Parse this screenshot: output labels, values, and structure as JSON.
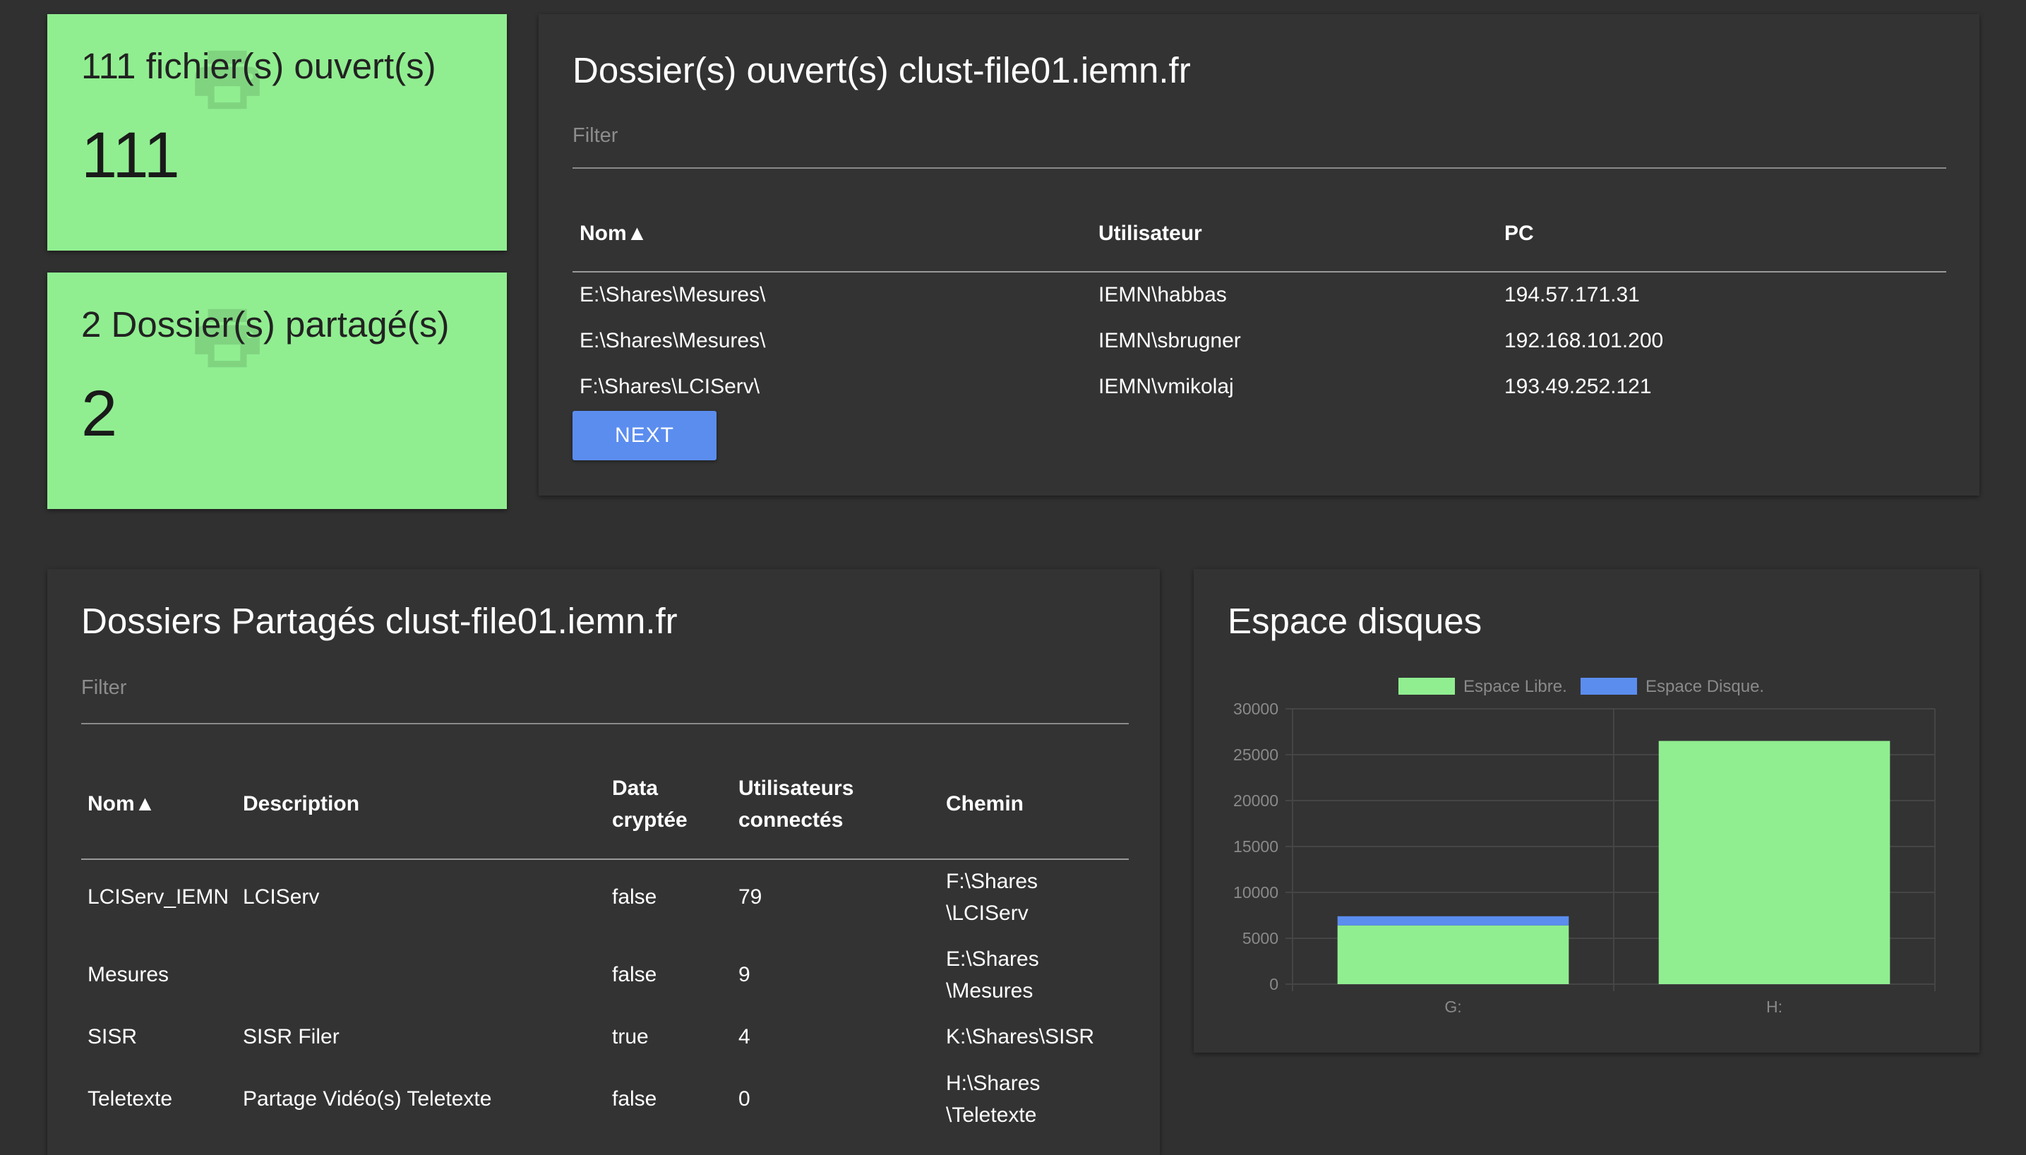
{
  "stats": [
    {
      "label": "111 fichier(s) ouvert(s)",
      "value": "111",
      "icon": "printer-icon"
    },
    {
      "label": "2 Dossier(s) partagé(s)",
      "value": "2",
      "icon": "printer-icon"
    }
  ],
  "open_files": {
    "title": "Dossier(s) ouvert(s) clust-file01.iemn.fr",
    "filter_placeholder": "Filter",
    "columns": [
      "Nom▲",
      "Utilisateur",
      "PC"
    ],
    "rows": [
      [
        "E:\\Shares\\Mesures\\",
        "IEMN\\habbas",
        "194.57.171.31"
      ],
      [
        "E:\\Shares\\Mesures\\",
        "IEMN\\sbrugner",
        "192.168.101.200"
      ],
      [
        "F:\\Shares\\LCIServ\\",
        "IEMN\\vmikolaj",
        "193.49.252.121"
      ]
    ],
    "next_label": "NEXT"
  },
  "shares": {
    "title": "Dossiers Partagés clust-file01.iemn.fr",
    "filter_placeholder": "Filter",
    "columns": {
      "nom": "Nom▲",
      "description": "Description",
      "data_line1": "Data",
      "data_line2": "cryptée",
      "users_line1": "Utilisateurs",
      "users_line2": "connectés",
      "chemin": "Chemin"
    },
    "rows": [
      {
        "nom": "LCIServ_IEMN",
        "description": "LCIServ",
        "crypted": "false",
        "users": "79",
        "path1": "F:\\Shares",
        "path2": "\\LCIServ"
      },
      {
        "nom": "Mesures",
        "description": "",
        "crypted": "false",
        "users": "9",
        "path1": "E:\\Shares",
        "path2": "\\Mesures"
      },
      {
        "nom": "SISR",
        "description": "SISR Filer",
        "crypted": "true",
        "users": "4",
        "path1": "K:\\Shares\\SISR",
        "path2": ""
      },
      {
        "nom": "Teletexte",
        "description": "Partage Vidéo(s) Teletexte",
        "crypted": "false",
        "users": "0",
        "path1": "H:\\Shares",
        "path2": "\\Teletexte"
      }
    ]
  },
  "disk": {
    "title": "Espace disques"
  },
  "colors": {
    "accent_green": "#90ee90",
    "accent_blue": "#5b8def",
    "card_bg": "#333333",
    "page_bg": "#303030"
  },
  "chart_data": {
    "type": "bar",
    "stacked": true,
    "categories": [
      "G:",
      "H:"
    ],
    "series": [
      {
        "name": "Espace Libre.",
        "color": "#90ee90",
        "values": [
          6400,
          26500
        ]
      },
      {
        "name": "Espace Disque.",
        "color": "#5b8def",
        "values": [
          1000,
          0
        ]
      }
    ],
    "ylim": [
      0,
      30000
    ],
    "yticks": [
      "0",
      "5000",
      "10000",
      "15000",
      "20000",
      "25000",
      "30000"
    ],
    "legend": "top",
    "grid": true
  }
}
